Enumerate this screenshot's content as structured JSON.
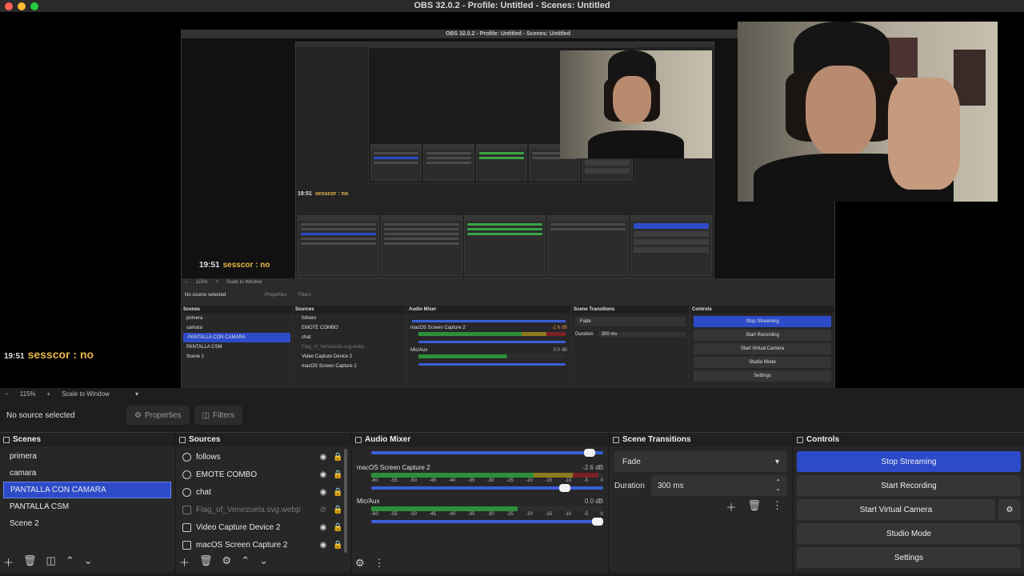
{
  "window": {
    "title": "OBS 32.0.2 - Profile: Untitled - Scenes: Untitled"
  },
  "nested_preview": {
    "title": "OBS 32.0.2 - Profile: Untitled - Scenes: Untitled",
    "chat_time": "19:51",
    "chat_text": "sesscor : no",
    "chat_time_small": "19:51",
    "chat_text_small": "sesscor : no",
    "zoom": "115%",
    "scale_mode": "Scale to Window",
    "no_source": "No source selected",
    "scenes": [
      "primera",
      "camara",
      "PANTALLA CON CAMARA",
      "PANTALLA CSM",
      "Scene 2"
    ],
    "sources": [
      "follows",
      "EMOTE COMBO",
      "chat",
      "Flag_of_Venezuela.svg.webp",
      "Video Capture Device 2",
      "macOS Screen Capture 2"
    ],
    "transition": "Fade",
    "duration_label": "Duration",
    "duration_value": "300 ms",
    "controls": [
      "Stop Streaming",
      "Start Recording",
      "Start Virtual Camera",
      "Studio Mode",
      "Settings"
    ],
    "mixer_track1": "macOS Screen Capture 2",
    "mixer_track1_db": "-2.6 dB",
    "mixer_track2": "Mic/Aux",
    "mixer_track2_db": "0.0 dB",
    "panel_scenes": "Scenes",
    "panel_sources": "Sources",
    "panel_mixer": "Audio Mixer",
    "panel_transitions": "Scene Transitions",
    "panel_controls": "Controls",
    "properties": "Properties",
    "filters": "Filters"
  },
  "chat_overlay": {
    "time": "19:51",
    "text": "sesscor : no"
  },
  "scale_row": {
    "minus": "−",
    "zoom": "115%",
    "plus": "+",
    "mode": "Scale to Window"
  },
  "props_bar": {
    "no_source": "No source selected",
    "properties": "Properties",
    "filters": "Filters"
  },
  "scenes": {
    "title": "Scenes",
    "items": [
      "primera",
      "camara",
      "PANTALLA CON CAMARA",
      "PANTALLA CSM",
      "Scene 2"
    ],
    "selected_index": 2
  },
  "sources": {
    "title": "Sources",
    "items": [
      {
        "name": "follows",
        "icon": "browser-source-icon",
        "visible": true
      },
      {
        "name": "EMOTE COMBO",
        "icon": "browser-source-icon",
        "visible": true
      },
      {
        "name": "chat",
        "icon": "browser-source-icon",
        "visible": true
      },
      {
        "name": "Flag_of_Venezuela.svg.webp",
        "icon": "image-source-icon",
        "visible": false
      },
      {
        "name": "Video Capture Device 2",
        "icon": "camera-icon",
        "visible": true
      },
      {
        "name": "macOS Screen Capture 2",
        "icon": "display-icon",
        "visible": true
      }
    ]
  },
  "mixer": {
    "title": "Audio Mixer",
    "ticks": [
      "-60",
      "-55",
      "-50",
      "-45",
      "-40",
      "-35",
      "-30",
      "-25",
      "-20",
      "-15",
      "-10",
      "-5",
      "0"
    ],
    "tracks": [
      {
        "name": "macOS Screen Capture 2",
        "db": "-2.6 dB",
        "level": 0.98,
        "volume": 0.86
      },
      {
        "name": "Mic/Aux",
        "db": "0.0 dB",
        "level": 0.63,
        "volume": 1.0
      }
    ]
  },
  "transitions": {
    "title": "Scene Transitions",
    "selected": "Fade",
    "duration_label": "Duration",
    "duration_value": "300 ms"
  },
  "controls": {
    "title": "Controls",
    "stop_streaming": "Stop Streaming",
    "start_recording": "Start Recording",
    "start_virtual_camera": "Start Virtual Camera",
    "studio_mode": "Studio Mode",
    "settings": "Settings"
  },
  "colors": {
    "accent": "#2d4bc9",
    "panel": "#272727",
    "background": "#1e1e1e"
  }
}
